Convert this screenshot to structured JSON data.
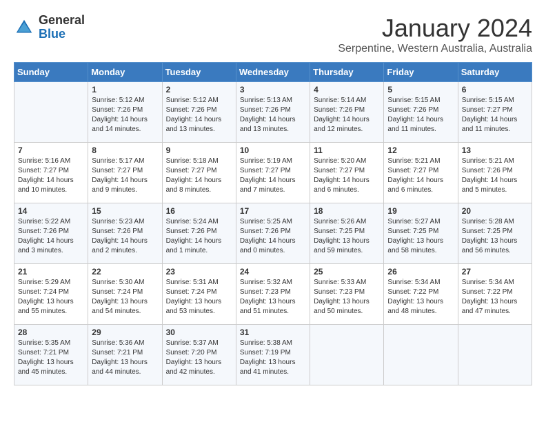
{
  "logo": {
    "general": "General",
    "blue": "Blue"
  },
  "title": "January 2024",
  "location": "Serpentine, Western Australia, Australia",
  "weekdays": [
    "Sunday",
    "Monday",
    "Tuesday",
    "Wednesday",
    "Thursday",
    "Friday",
    "Saturday"
  ],
  "weeks": [
    [
      {
        "day": "",
        "info": ""
      },
      {
        "day": "1",
        "info": "Sunrise: 5:12 AM\nSunset: 7:26 PM\nDaylight: 14 hours\nand 14 minutes."
      },
      {
        "day": "2",
        "info": "Sunrise: 5:12 AM\nSunset: 7:26 PM\nDaylight: 14 hours\nand 13 minutes."
      },
      {
        "day": "3",
        "info": "Sunrise: 5:13 AM\nSunset: 7:26 PM\nDaylight: 14 hours\nand 13 minutes."
      },
      {
        "day": "4",
        "info": "Sunrise: 5:14 AM\nSunset: 7:26 PM\nDaylight: 14 hours\nand 12 minutes."
      },
      {
        "day": "5",
        "info": "Sunrise: 5:15 AM\nSunset: 7:26 PM\nDaylight: 14 hours\nand 11 minutes."
      },
      {
        "day": "6",
        "info": "Sunrise: 5:15 AM\nSunset: 7:27 PM\nDaylight: 14 hours\nand 11 minutes."
      }
    ],
    [
      {
        "day": "7",
        "info": "Sunrise: 5:16 AM\nSunset: 7:27 PM\nDaylight: 14 hours\nand 10 minutes."
      },
      {
        "day": "8",
        "info": "Sunrise: 5:17 AM\nSunset: 7:27 PM\nDaylight: 14 hours\nand 9 minutes."
      },
      {
        "day": "9",
        "info": "Sunrise: 5:18 AM\nSunset: 7:27 PM\nDaylight: 14 hours\nand 8 minutes."
      },
      {
        "day": "10",
        "info": "Sunrise: 5:19 AM\nSunset: 7:27 PM\nDaylight: 14 hours\nand 7 minutes."
      },
      {
        "day": "11",
        "info": "Sunrise: 5:20 AM\nSunset: 7:27 PM\nDaylight: 14 hours\nand 6 minutes."
      },
      {
        "day": "12",
        "info": "Sunrise: 5:21 AM\nSunset: 7:27 PM\nDaylight: 14 hours\nand 6 minutes."
      },
      {
        "day": "13",
        "info": "Sunrise: 5:21 AM\nSunset: 7:26 PM\nDaylight: 14 hours\nand 5 minutes."
      }
    ],
    [
      {
        "day": "14",
        "info": "Sunrise: 5:22 AM\nSunset: 7:26 PM\nDaylight: 14 hours\nand 3 minutes."
      },
      {
        "day": "15",
        "info": "Sunrise: 5:23 AM\nSunset: 7:26 PM\nDaylight: 14 hours\nand 2 minutes."
      },
      {
        "day": "16",
        "info": "Sunrise: 5:24 AM\nSunset: 7:26 PM\nDaylight: 14 hours\nand 1 minute."
      },
      {
        "day": "17",
        "info": "Sunrise: 5:25 AM\nSunset: 7:26 PM\nDaylight: 14 hours\nand 0 minutes."
      },
      {
        "day": "18",
        "info": "Sunrise: 5:26 AM\nSunset: 7:25 PM\nDaylight: 13 hours\nand 59 minutes."
      },
      {
        "day": "19",
        "info": "Sunrise: 5:27 AM\nSunset: 7:25 PM\nDaylight: 13 hours\nand 58 minutes."
      },
      {
        "day": "20",
        "info": "Sunrise: 5:28 AM\nSunset: 7:25 PM\nDaylight: 13 hours\nand 56 minutes."
      }
    ],
    [
      {
        "day": "21",
        "info": "Sunrise: 5:29 AM\nSunset: 7:24 PM\nDaylight: 13 hours\nand 55 minutes."
      },
      {
        "day": "22",
        "info": "Sunrise: 5:30 AM\nSunset: 7:24 PM\nDaylight: 13 hours\nand 54 minutes."
      },
      {
        "day": "23",
        "info": "Sunrise: 5:31 AM\nSunset: 7:24 PM\nDaylight: 13 hours\nand 53 minutes."
      },
      {
        "day": "24",
        "info": "Sunrise: 5:32 AM\nSunset: 7:23 PM\nDaylight: 13 hours\nand 51 minutes."
      },
      {
        "day": "25",
        "info": "Sunrise: 5:33 AM\nSunset: 7:23 PM\nDaylight: 13 hours\nand 50 minutes."
      },
      {
        "day": "26",
        "info": "Sunrise: 5:34 AM\nSunset: 7:22 PM\nDaylight: 13 hours\nand 48 minutes."
      },
      {
        "day": "27",
        "info": "Sunrise: 5:34 AM\nSunset: 7:22 PM\nDaylight: 13 hours\nand 47 minutes."
      }
    ],
    [
      {
        "day": "28",
        "info": "Sunrise: 5:35 AM\nSunset: 7:21 PM\nDaylight: 13 hours\nand 45 minutes."
      },
      {
        "day": "29",
        "info": "Sunrise: 5:36 AM\nSunset: 7:21 PM\nDaylight: 13 hours\nand 44 minutes."
      },
      {
        "day": "30",
        "info": "Sunrise: 5:37 AM\nSunset: 7:20 PM\nDaylight: 13 hours\nand 42 minutes."
      },
      {
        "day": "31",
        "info": "Sunrise: 5:38 AM\nSunset: 7:19 PM\nDaylight: 13 hours\nand 41 minutes."
      },
      {
        "day": "",
        "info": ""
      },
      {
        "day": "",
        "info": ""
      },
      {
        "day": "",
        "info": ""
      }
    ]
  ]
}
